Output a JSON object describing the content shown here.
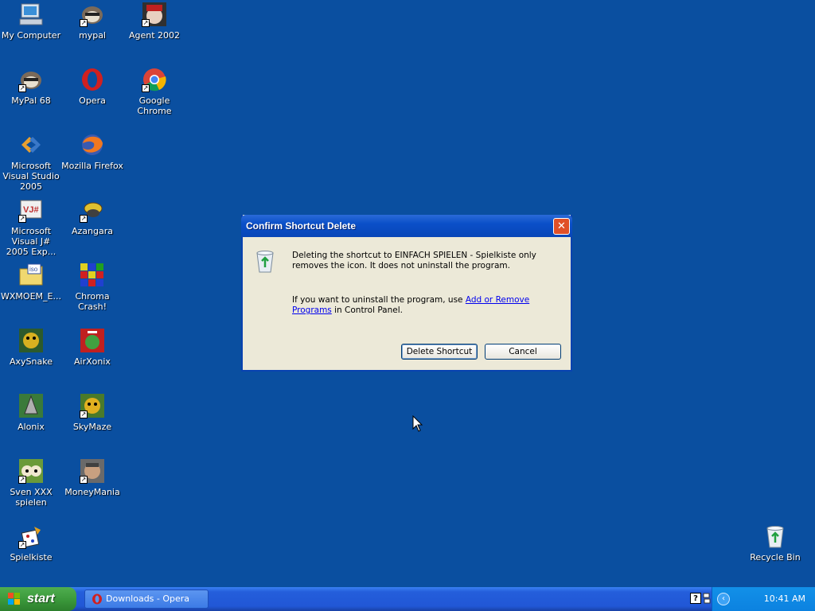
{
  "desktop": {
    "icons": [
      {
        "label": "My Computer"
      },
      {
        "label": "mypal"
      },
      {
        "label": "Agent 2002"
      },
      {
        "label": "MyPal 68"
      },
      {
        "label": "Opera"
      },
      {
        "label": "Google Chrome"
      },
      {
        "label": "Microsoft Visual Studio 2005"
      },
      {
        "label": "Mozilla Firefox"
      },
      {
        "label": "Microsoft Visual J# 2005 Exp..."
      },
      {
        "label": "Azangara"
      },
      {
        "label": "WXMOEM_E..."
      },
      {
        "label": "Chroma Crash!"
      },
      {
        "label": "AxySnake"
      },
      {
        "label": "AirXonix"
      },
      {
        "label": "Alonix"
      },
      {
        "label": "SkyMaze"
      },
      {
        "label": "Sven XXX spielen"
      },
      {
        "label": "MoneyMania"
      },
      {
        "label": "Spielkiste"
      },
      {
        "label": "Recycle Bin"
      }
    ]
  },
  "dialog": {
    "title": "Confirm Shortcut Delete",
    "close_label": "✕",
    "message1": "Deleting the shortcut to EINFACH SPIELEN - Spielkiste only removes the icon. It does not uninstall the program.",
    "message2_pre": "If you want to uninstall the program, use ",
    "message2_link": "Add or Remove Programs",
    "message2_post": " in Control Panel.",
    "delete_button": "Delete Shortcut",
    "cancel_button": "Cancel"
  },
  "taskbar": {
    "start_label": "start",
    "task_label": "Downloads - Opera",
    "clock": "10:41 AM"
  },
  "colors": {
    "desktop": "#0a4fa0",
    "titlebar": "#0a4fc8",
    "dialog_bg": "#ece9d8",
    "start_green": "#3c9a3c"
  }
}
